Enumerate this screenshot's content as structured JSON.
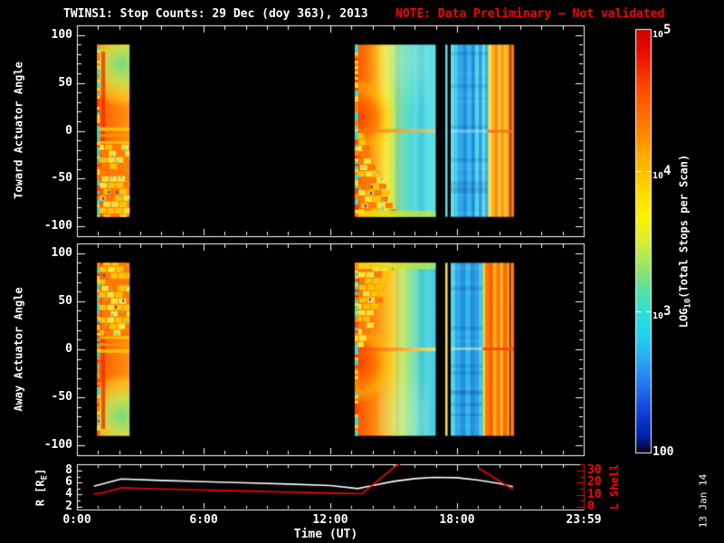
{
  "title": {
    "main": "TWINS1: Stop Counts: 29 Dec (doy 363), 2013",
    "note": "NOTE: Data Preliminary – Not validated"
  },
  "colors": {
    "background": "#000000",
    "foreground": "#ffffff",
    "note_red": "#ff0000",
    "frame": "#ffffff",
    "r_line": "#ffffff",
    "l_shell_line": "#ff0000"
  },
  "xaxis": {
    "label": "Time (UT)",
    "range_hours": [
      0,
      24
    ],
    "tick_hours": [
      0,
      6,
      12,
      18,
      24
    ],
    "tick_labels": [
      "0:00",
      "6:00",
      "12:00",
      "18:00",
      "23:59"
    ]
  },
  "panels": {
    "toward": {
      "ylabel": "Toward Actuator Angle",
      "yticks": [
        100,
        50,
        0,
        -50,
        -100
      ],
      "yrange": [
        -110,
        110
      ]
    },
    "away": {
      "ylabel": "Away Actuator Angle",
      "yticks": [
        100,
        50,
        0,
        -50,
        -100
      ],
      "yrange": [
        -110,
        110
      ]
    },
    "orbit": {
      "left_label_pre": "R [R",
      "left_label_sub": "E",
      "left_label_post": "]",
      "left_ticks": [
        8,
        6,
        4,
        2
      ],
      "left_range": [
        1.5,
        9.05
      ],
      "right_label": "L Shell",
      "right_ticks": [
        30,
        20,
        10,
        0
      ],
      "right_range": [
        -2.3,
        35.3
      ]
    }
  },
  "colorbar": {
    "title_pre": "LOG",
    "title_sub": "10",
    "title_post": "(Total Stops per Scan)",
    "range_log10": [
      2,
      5
    ],
    "tick_labels": [
      {
        "base": "10",
        "exp": "5",
        "decade": 5
      },
      {
        "base": "10",
        "exp": "4",
        "decade": 4
      },
      {
        "base": "10",
        "exp": "3",
        "decade": 3
      },
      {
        "plain": "100",
        "decade": 2
      }
    ],
    "stops": [
      [
        0,
        "#cc0000"
      ],
      [
        0.06,
        "#ee1100"
      ],
      [
        0.13,
        "#ff4400"
      ],
      [
        0.22,
        "#ff7700"
      ],
      [
        0.3,
        "#ffaa00"
      ],
      [
        0.38,
        "#ffd800"
      ],
      [
        0.44,
        "#fff200"
      ],
      [
        0.5,
        "#d8ee33"
      ],
      [
        0.56,
        "#9ae465"
      ],
      [
        0.62,
        "#55dfa8"
      ],
      [
        0.67,
        "#2ee0d4"
      ],
      [
        0.72,
        "#22d4ee"
      ],
      [
        0.78,
        "#2aa8f0"
      ],
      [
        0.84,
        "#2277ee"
      ],
      [
        0.9,
        "#1144dd"
      ],
      [
        0.96,
        "#0022aa"
      ],
      [
        0.985,
        "#001155"
      ],
      [
        1,
        "#000000"
      ]
    ]
  },
  "datestamp": "13 Jan 14",
  "chart_data": [
    {
      "type": "heatmap",
      "panel": "toward",
      "title": "Toward Actuator Angle vs Time, log10 stop counts (100 to 1e5)",
      "x_unit": "hours UT",
      "y_unit": "degrees",
      "flip": false,
      "segments": [
        {
          "t0": 0.95,
          "t1": 2.5,
          "a0": -90,
          "a1": 90,
          "pattern": "blob-left",
          "desc": "high counts ~1e4.7: orange/red column, yellow-green patch upper right, scalloped yellow/orange interference below 0 deg",
          "stops": [
            [
              0,
              "#ff5200"
            ],
            [
              0.55,
              "#ff7a08"
            ],
            [
              1,
              "#ff9214"
            ]
          ]
        },
        {
          "t0": 13.15,
          "t1": 17.0,
          "a0": -90,
          "a1": 90,
          "pattern": "blob-main",
          "desc": "orange ~1e4.8 left third with scalloped lower-left, teal/cyan ~1e3.5 right side, orange stripe at 0 deg, yellow-green band at -90",
          "stops": [
            [
              0,
              "#ff4a00"
            ],
            [
              0.16,
              "#ff7a08"
            ],
            [
              0.28,
              "#ffb81e"
            ],
            [
              0.38,
              "#ffe83c"
            ],
            [
              0.48,
              "#c2ea5e"
            ],
            [
              0.58,
              "#6fdfb2"
            ],
            [
              0.72,
              "#4cd8dc"
            ],
            [
              1,
              "#5ee0e8"
            ]
          ],
          "zcolors": [
            "rgba(255,100,0,0.9)",
            "rgba(255,200,80,0.65)"
          ]
        },
        {
          "t0": 17.44,
          "t1": 17.56,
          "a0": -90,
          "a1": 90,
          "pattern": "sliver",
          "color": "#55dde8",
          "desc": "narrow cyan data sliver between black gaps"
        },
        {
          "t0": 17.7,
          "t1": 20.7,
          "a0": -90,
          "a1": 90,
          "pattern": "stripes",
          "desc": "blue/cyan vertical striping ~1e3 then yellow-orange stripes ~1e4.5 after 19:30, thin black dropout near end",
          "zsplit": 0.58,
          "zcolors": [
            "rgba(190,240,255,0.45)",
            "rgba(255,110,20,0.9)"
          ],
          "stripes": [
            {
              "w": 0.05,
              "c": "#66dde8"
            },
            {
              "w": 0.06,
              "c": "#44c8e8"
            },
            {
              "w": 0.08,
              "c": "#2fa8e8"
            },
            {
              "w": 0.05,
              "c": "#2090e0"
            },
            {
              "w": 0.07,
              "c": "#38b8e8"
            },
            {
              "w": 0.05,
              "c": "#1f8ee0"
            },
            {
              "w": 0.06,
              "c": "#55d0e8"
            },
            {
              "w": 0.05,
              "c": "#2f9fe0"
            },
            {
              "w": 0.04,
              "c": "#66dde8"
            },
            {
              "w": 0.05,
              "c": "#3fb0e0"
            },
            {
              "w": 0.045,
              "c": "#ffe24a"
            },
            {
              "w": 0.05,
              "c": "#ffb020"
            },
            {
              "w": 0.05,
              "c": "#ff8c10"
            },
            {
              "w": 0.04,
              "c": "#ffd23a"
            },
            {
              "w": 0.05,
              "c": "#ff9a14"
            },
            {
              "w": 0.05,
              "c": "#ffc22e"
            },
            {
              "w": 0.04,
              "c": "#ff8c10"
            },
            {
              "w": 0.012,
              "c": "#000000"
            },
            {
              "w": 0.048,
              "c": "#ff7a08"
            }
          ]
        }
      ]
    },
    {
      "type": "heatmap",
      "panel": "away",
      "title": "Away Actuator Angle vs Time, log10 stop counts (100 to 1e5) — vertically mirrored structure",
      "x_unit": "hours UT",
      "y_unit": "degrees",
      "flip": true,
      "segments": [
        {
          "t0": 0.95,
          "t1": 2.5,
          "a0": -90,
          "a1": 90,
          "pattern": "blob-left",
          "desc": "orange/red column, scallops above 0 deg, yellow-green patch lower right",
          "stops": [
            [
              0,
              "#ff5200"
            ],
            [
              0.55,
              "#ff7a08"
            ],
            [
              1,
              "#ff9214"
            ]
          ]
        },
        {
          "t0": 13.15,
          "t1": 17.0,
          "a0": -90,
          "a1": 90,
          "pattern": "blob-main",
          "desc": "orange upper-left with scalloped upper-left corner, cyan lower-right, yellow stripe at 0 deg",
          "stops": [
            [
              0,
              "#ff4a00"
            ],
            [
              0.2,
              "#ff7a08"
            ],
            [
              0.42,
              "#ffc22a"
            ],
            [
              0.55,
              "#e8ec50"
            ],
            [
              0.68,
              "#8fe49a"
            ],
            [
              0.82,
              "#50d8d4"
            ],
            [
              1,
              "#44cce8"
            ]
          ],
          "zcolors": [
            "rgba(255,60,0,0.9)",
            "rgba(255,235,90,0.8)"
          ]
        },
        {
          "t0": 17.44,
          "t1": 17.56,
          "a0": -90,
          "a1": 90,
          "pattern": "sliver",
          "color": "#ffe040",
          "desc": "narrow yellow data sliver between black gaps"
        },
        {
          "t0": 17.7,
          "t1": 20.7,
          "a0": -90,
          "a1": 90,
          "pattern": "stripes",
          "desc": "cyan/blue striping then strong orange/red vertical stripes ~1e4.8 after 19:15",
          "zsplit": 0.5,
          "zcolors": [
            "rgba(230,250,180,0.5)",
            "rgba(255,70,0,0.9)"
          ],
          "stripes": [
            {
              "w": 0.06,
              "c": "#55d4e8"
            },
            {
              "w": 0.08,
              "c": "#2fa8e8"
            },
            {
              "w": 0.07,
              "c": "#2090e0"
            },
            {
              "w": 0.07,
              "c": "#38b8e8"
            },
            {
              "w": 0.06,
              "c": "#1f8ee0"
            },
            {
              "w": 0.06,
              "c": "#2f9fe0"
            },
            {
              "w": 0.06,
              "c": "#44c8e8"
            },
            {
              "w": 0.03,
              "c": "#ffd23a"
            },
            {
              "w": 0.06,
              "c": "#ff7a08"
            },
            {
              "w": 0.05,
              "c": "#ff5c00"
            },
            {
              "w": 0.05,
              "c": "#ffb020"
            },
            {
              "w": 0.06,
              "c": "#ff7a08"
            },
            {
              "w": 0.03,
              "c": "#ffd23a"
            },
            {
              "w": 0.06,
              "c": "#ff6a00"
            },
            {
              "w": 0.04,
              "c": "#ff9a14"
            },
            {
              "w": 0.012,
              "c": "#000000"
            },
            {
              "w": 0.05,
              "c": "#ff7a08"
            }
          ]
        }
      ]
    },
    {
      "type": "line",
      "title": "Spacecraft radial distance and L Shell vs Time",
      "series": [
        {
          "name": "R [RE]",
          "color": "#ffffff",
          "axis": "left",
          "segments": [
            [
              [
                0.8,
                5.4
              ],
              [
                2.1,
                6.6
              ],
              [
                4,
                6.35
              ],
              [
                6,
                6.15
              ],
              [
                8,
                5.95
              ],
              [
                10,
                5.75
              ],
              [
                12,
                5.5
              ],
              [
                13.3,
                5.0
              ],
              [
                14,
                5.5
              ],
              [
                15,
                6.2
              ],
              [
                16,
                6.65
              ],
              [
                16.9,
                6.87
              ],
              [
                18,
                6.8
              ],
              [
                19,
                6.4
              ],
              [
                20,
                5.85
              ],
              [
                20.65,
                5.3
              ]
            ]
          ]
        },
        {
          "name": "L Shell",
          "color": "#ff0000",
          "axis": "right",
          "segments": [
            [
              [
                0.8,
                10.5
              ],
              [
                1.2,
                11.5
              ],
              [
                2.1,
                15.7
              ],
              [
                4,
                14.8
              ],
              [
                6,
                13.9
              ],
              [
                8,
                13.0
              ],
              [
                10,
                12.2
              ],
              [
                12,
                11.3
              ],
              [
                13.5,
                10.9
              ],
              [
                15.1,
                33.8
              ],
              [
                15.3,
                35.5
              ]
            ],
            [
              [
                19.0,
                32.3
              ],
              [
                20.65,
                14.3
              ]
            ]
          ]
        }
      ]
    }
  ]
}
